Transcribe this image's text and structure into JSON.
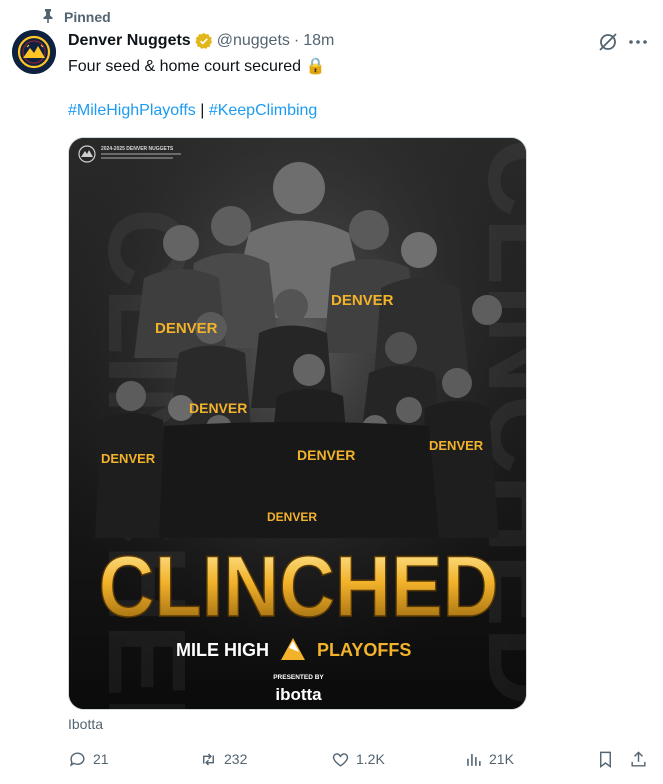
{
  "pinned": {
    "label": "Pinned",
    "icon": "pin-icon"
  },
  "author": {
    "display_name": "Denver Nuggets",
    "handle": "@nuggets",
    "separator": "·",
    "time": "18m",
    "verified_icon": "verified-badge-icon",
    "avatar_icon": "nuggets-logo"
  },
  "tweet": {
    "text": "Four seed & home court secured 🔒",
    "hashtag1": "#MileHighPlayoffs",
    "separator": " | ",
    "hashtag2": "#KeepClimbing"
  },
  "media": {
    "header_text": "2024-2025 DENVER NUGGETS",
    "headline": "CLINCHED",
    "sub_left": "MILE HIGH",
    "sub_right": "PLAYOFFS",
    "presented_by": "PRESENTED BY",
    "sponsor": "ibotta",
    "jersey_text": "DENVER"
  },
  "source": {
    "label": "Ibotta"
  },
  "actions": {
    "reply_count": "21",
    "retweet_count": "232",
    "like_count": "1.2K",
    "views_count": "21K"
  },
  "colors": {
    "accent": "#1d9bf0",
    "gold": "#f2b22a",
    "navy": "#0e2240",
    "muted": "#536471"
  }
}
